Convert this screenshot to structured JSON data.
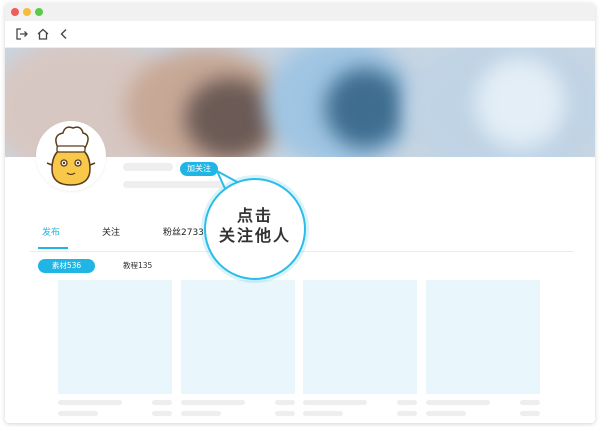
{
  "window": {
    "controls": [
      "close",
      "minimize",
      "maximize"
    ]
  },
  "toolbar": {
    "icons": [
      "logout-icon",
      "home-icon",
      "back-icon"
    ]
  },
  "profile": {
    "follow_button": "加关注"
  },
  "tabs": [
    {
      "label": "发布",
      "active": true
    },
    {
      "label": "关注",
      "active": false
    },
    {
      "label": "粉丝2733",
      "active": false
    }
  ],
  "subtabs": [
    {
      "label": "素材536",
      "active": true
    },
    {
      "label": "教程135",
      "active": false
    }
  ],
  "callout": {
    "line1": "点击",
    "line2": "关注他人"
  },
  "colors": {
    "accent": "#1fb6e6",
    "card_bg": "#e9f7fd",
    "skeleton": "#eeeeee"
  }
}
